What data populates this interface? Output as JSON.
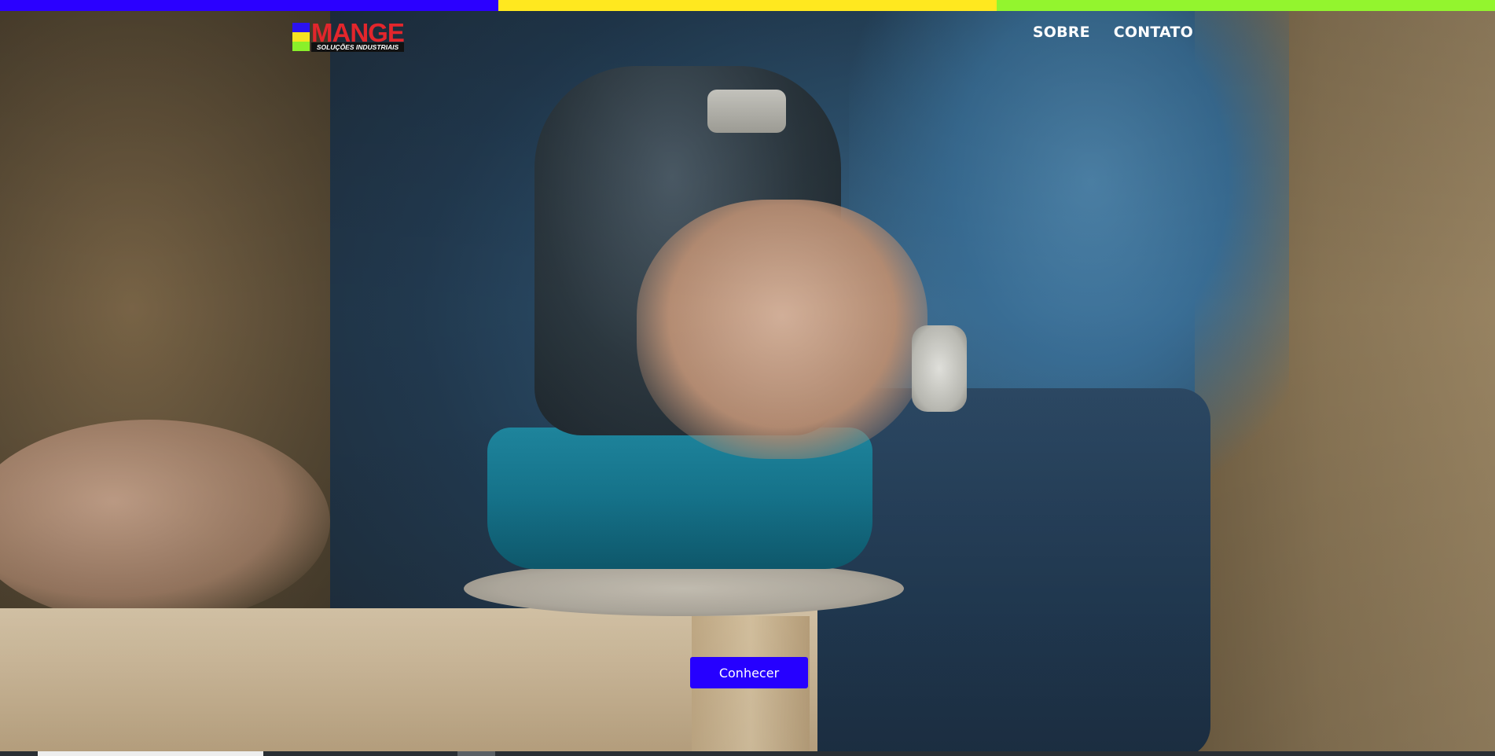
{
  "brand": {
    "name": "MANGE",
    "tagline": "SOLUÇÕES INDUSTRIAIS",
    "name_color": "#e3262c",
    "logo_colors": [
      "#2b12f0",
      "#f6e321",
      "#8af02a"
    ]
  },
  "topbar": {
    "colors": [
      "#2b00ff",
      "#ffe81f",
      "#93f52e"
    ]
  },
  "nav": {
    "items": [
      {
        "label": "SOBRE"
      },
      {
        "label": "CONTATO"
      }
    ]
  },
  "hero": {
    "image": "man-using-orbital-sander-on-wood-photo",
    "cta_label": "Conhecer",
    "cta_color": "#2600ff"
  }
}
